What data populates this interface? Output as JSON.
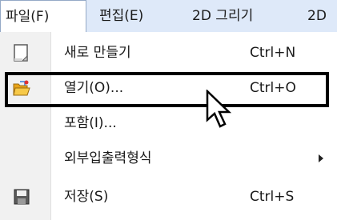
{
  "menubar": {
    "items": [
      {
        "label": "파일(F)"
      },
      {
        "label": "편집(E)"
      },
      {
        "label": "2D 그리기"
      },
      {
        "label": "2D"
      }
    ]
  },
  "dropdown": {
    "items": [
      {
        "label": "새로 만들기",
        "shortcut": "Ctrl+N",
        "icon": "new-document-icon"
      },
      {
        "label": "열기(O)...",
        "shortcut": "Ctrl+O",
        "icon": "open-folder-icon"
      },
      {
        "label": "포함(I)...",
        "shortcut": "",
        "icon": ""
      },
      {
        "label": "외부입출력형식",
        "shortcut": "",
        "icon": "",
        "submenu": true
      },
      {
        "label": "저장(S)",
        "shortcut": "Ctrl+S",
        "icon": "save-disk-icon"
      }
    ]
  },
  "colors": {
    "menubar_bg": "#dee9f9",
    "gutter_bg": "#f1f1f1",
    "highlight_border": "#000000"
  }
}
